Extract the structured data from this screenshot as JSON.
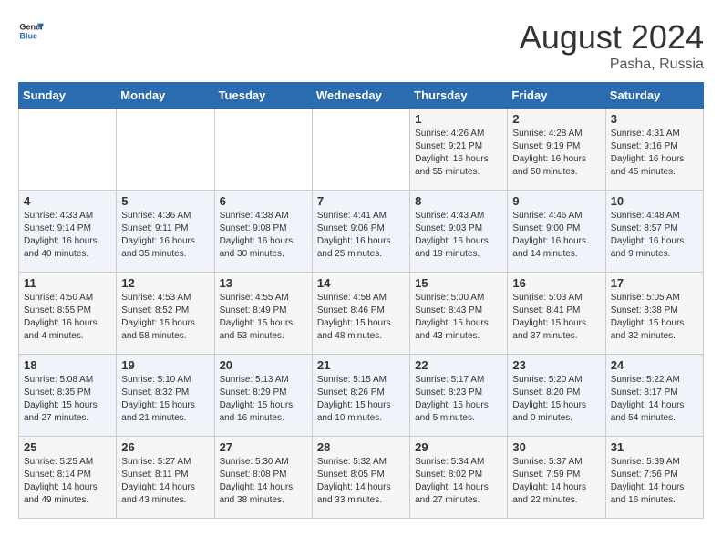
{
  "header": {
    "logo_line1": "General",
    "logo_line2": "Blue",
    "month_year": "August 2024",
    "location": "Pasha, Russia"
  },
  "days_of_week": [
    "Sunday",
    "Monday",
    "Tuesday",
    "Wednesday",
    "Thursday",
    "Friday",
    "Saturday"
  ],
  "weeks": [
    [
      {
        "day": "",
        "info": ""
      },
      {
        "day": "",
        "info": ""
      },
      {
        "day": "",
        "info": ""
      },
      {
        "day": "",
        "info": ""
      },
      {
        "day": "1",
        "info": "Sunrise: 4:26 AM\nSunset: 9:21 PM\nDaylight: 16 hours\nand 55 minutes."
      },
      {
        "day": "2",
        "info": "Sunrise: 4:28 AM\nSunset: 9:19 PM\nDaylight: 16 hours\nand 50 minutes."
      },
      {
        "day": "3",
        "info": "Sunrise: 4:31 AM\nSunset: 9:16 PM\nDaylight: 16 hours\nand 45 minutes."
      }
    ],
    [
      {
        "day": "4",
        "info": "Sunrise: 4:33 AM\nSunset: 9:14 PM\nDaylight: 16 hours\nand 40 minutes."
      },
      {
        "day": "5",
        "info": "Sunrise: 4:36 AM\nSunset: 9:11 PM\nDaylight: 16 hours\nand 35 minutes."
      },
      {
        "day": "6",
        "info": "Sunrise: 4:38 AM\nSunset: 9:08 PM\nDaylight: 16 hours\nand 30 minutes."
      },
      {
        "day": "7",
        "info": "Sunrise: 4:41 AM\nSunset: 9:06 PM\nDaylight: 16 hours\nand 25 minutes."
      },
      {
        "day": "8",
        "info": "Sunrise: 4:43 AM\nSunset: 9:03 PM\nDaylight: 16 hours\nand 19 minutes."
      },
      {
        "day": "9",
        "info": "Sunrise: 4:46 AM\nSunset: 9:00 PM\nDaylight: 16 hours\nand 14 minutes."
      },
      {
        "day": "10",
        "info": "Sunrise: 4:48 AM\nSunset: 8:57 PM\nDaylight: 16 hours\nand 9 minutes."
      }
    ],
    [
      {
        "day": "11",
        "info": "Sunrise: 4:50 AM\nSunset: 8:55 PM\nDaylight: 16 hours\nand 4 minutes."
      },
      {
        "day": "12",
        "info": "Sunrise: 4:53 AM\nSunset: 8:52 PM\nDaylight: 15 hours\nand 58 minutes."
      },
      {
        "day": "13",
        "info": "Sunrise: 4:55 AM\nSunset: 8:49 PM\nDaylight: 15 hours\nand 53 minutes."
      },
      {
        "day": "14",
        "info": "Sunrise: 4:58 AM\nSunset: 8:46 PM\nDaylight: 15 hours\nand 48 minutes."
      },
      {
        "day": "15",
        "info": "Sunrise: 5:00 AM\nSunset: 8:43 PM\nDaylight: 15 hours\nand 43 minutes."
      },
      {
        "day": "16",
        "info": "Sunrise: 5:03 AM\nSunset: 8:41 PM\nDaylight: 15 hours\nand 37 minutes."
      },
      {
        "day": "17",
        "info": "Sunrise: 5:05 AM\nSunset: 8:38 PM\nDaylight: 15 hours\nand 32 minutes."
      }
    ],
    [
      {
        "day": "18",
        "info": "Sunrise: 5:08 AM\nSunset: 8:35 PM\nDaylight: 15 hours\nand 27 minutes."
      },
      {
        "day": "19",
        "info": "Sunrise: 5:10 AM\nSunset: 8:32 PM\nDaylight: 15 hours\nand 21 minutes."
      },
      {
        "day": "20",
        "info": "Sunrise: 5:13 AM\nSunset: 8:29 PM\nDaylight: 15 hours\nand 16 minutes."
      },
      {
        "day": "21",
        "info": "Sunrise: 5:15 AM\nSunset: 8:26 PM\nDaylight: 15 hours\nand 10 minutes."
      },
      {
        "day": "22",
        "info": "Sunrise: 5:17 AM\nSunset: 8:23 PM\nDaylight: 15 hours\nand 5 minutes."
      },
      {
        "day": "23",
        "info": "Sunrise: 5:20 AM\nSunset: 8:20 PM\nDaylight: 15 hours\nand 0 minutes."
      },
      {
        "day": "24",
        "info": "Sunrise: 5:22 AM\nSunset: 8:17 PM\nDaylight: 14 hours\nand 54 minutes."
      }
    ],
    [
      {
        "day": "25",
        "info": "Sunrise: 5:25 AM\nSunset: 8:14 PM\nDaylight: 14 hours\nand 49 minutes."
      },
      {
        "day": "26",
        "info": "Sunrise: 5:27 AM\nSunset: 8:11 PM\nDaylight: 14 hours\nand 43 minutes."
      },
      {
        "day": "27",
        "info": "Sunrise: 5:30 AM\nSunset: 8:08 PM\nDaylight: 14 hours\nand 38 minutes."
      },
      {
        "day": "28",
        "info": "Sunrise: 5:32 AM\nSunset: 8:05 PM\nDaylight: 14 hours\nand 33 minutes."
      },
      {
        "day": "29",
        "info": "Sunrise: 5:34 AM\nSunset: 8:02 PM\nDaylight: 14 hours\nand 27 minutes."
      },
      {
        "day": "30",
        "info": "Sunrise: 5:37 AM\nSunset: 7:59 PM\nDaylight: 14 hours\nand 22 minutes."
      },
      {
        "day": "31",
        "info": "Sunrise: 5:39 AM\nSunset: 7:56 PM\nDaylight: 14 hours\nand 16 minutes."
      }
    ]
  ]
}
